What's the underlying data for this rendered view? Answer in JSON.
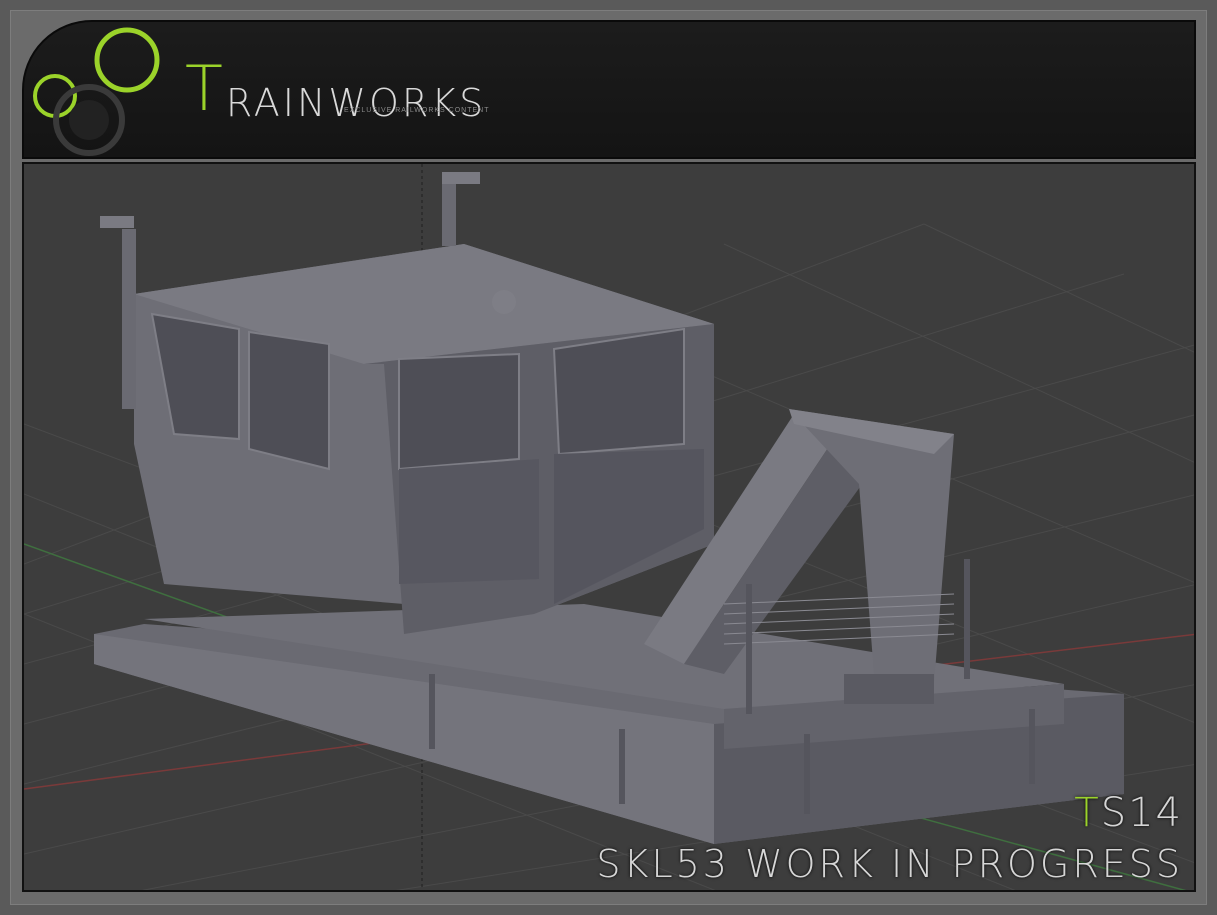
{
  "header": {
    "brand_first": "T",
    "brand_rest": "RAINWORKS",
    "tagline": "EXCLUSIVE RAILWORKS CONTENT"
  },
  "badge": {
    "prefix": "T",
    "rest": "S14"
  },
  "caption": "SKL53 WORK IN PROGRESS",
  "colors": {
    "accent": "#9bd32a",
    "text": "#d9d9d9",
    "viewport_bg": "#3d3d3d",
    "header_bg": "#161616",
    "model": "#6e6e78"
  },
  "icons": [
    "logo-circles-icon"
  ]
}
